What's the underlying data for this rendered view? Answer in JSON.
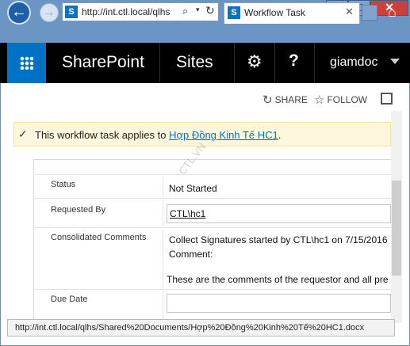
{
  "window": {
    "minimize": "–",
    "maximize": "□",
    "close": "✕"
  },
  "browser": {
    "back_icon": "←",
    "forward_icon": "→",
    "address_url": "http://int.ctl.local/qlhs",
    "tab_title": "Workflow Task",
    "tab_close": "✕",
    "home_icon": "⌂",
    "search_icon": "⌕",
    "dropdown_icon": "▾",
    "refresh_icon": "↻",
    "site_icon_letter": "S"
  },
  "suitebar": {
    "brand": "SharePoint",
    "sites": "Sites",
    "settings_icon": "⚙",
    "help": "?",
    "user": "giamdoc"
  },
  "actions": {
    "share_icon": "↻",
    "share": "SHARE",
    "follow_icon": "☆",
    "follow": "FOLLOW"
  },
  "banner": {
    "check_icon": "✓",
    "text": "This workflow task applies to ",
    "link": "Hợp Đồng Kinh Tế HC1",
    "period": "."
  },
  "form": {
    "status_label": "Status",
    "status_value": "Not Started",
    "requested_by_label": "Requested By",
    "requested_by_value": "CTL\\hc1",
    "comments_label": "Consolidated Comments",
    "comments_line1": "Collect Signatures started by CTL\\hc1 on 7/15/2016",
    "comments_line2": "Comment:",
    "comments_line3": "These are the comments of the requestor and all pre",
    "due_date_label": "Due Date",
    "due_date_value": ""
  },
  "watermark": "CTL.VN",
  "statusbar": {
    "url": "http://int.ctl.local/qlhs/Shared%20Documents/Hợp%20Đồng%20Kinh%20Tế%20HC1.docx"
  }
}
